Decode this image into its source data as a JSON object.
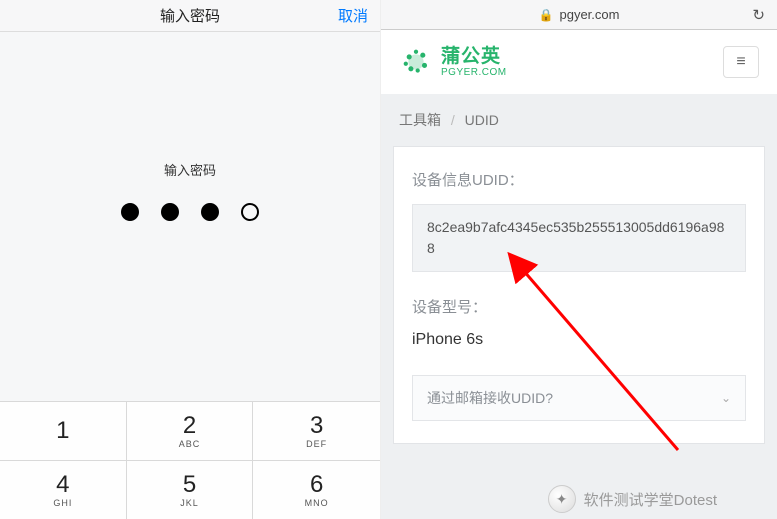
{
  "left": {
    "header_title": "输入密码",
    "cancel": "取消",
    "prompt": "输入密码",
    "dots_filled": [
      true,
      true,
      true,
      false
    ],
    "keys": [
      {
        "num": "1",
        "letters": ""
      },
      {
        "num": "2",
        "letters": "ABC"
      },
      {
        "num": "3",
        "letters": "DEF"
      },
      {
        "num": "4",
        "letters": "GHI"
      },
      {
        "num": "5",
        "letters": "JKL"
      },
      {
        "num": "6",
        "letters": "MNO"
      }
    ]
  },
  "right": {
    "url_host": "pgyer.com",
    "logo_cn": "蒲公英",
    "logo_en": "PGYER.COM",
    "breadcrumb_a": "工具箱",
    "breadcrumb_b": "UDID",
    "udid_label": "设备信息UDID：",
    "udid_value": "8c2ea9b7afc4345ec535b255513005dd6196a988",
    "model_label": "设备型号：",
    "model_value": "iPhone 6s",
    "email_label": "通过邮箱接收UDID?"
  },
  "watermark": {
    "text": "软件测试学堂Dotest"
  },
  "colors": {
    "brand": "#27b46c",
    "ios_blue": "#007aff",
    "arrow": "#ff0000"
  }
}
